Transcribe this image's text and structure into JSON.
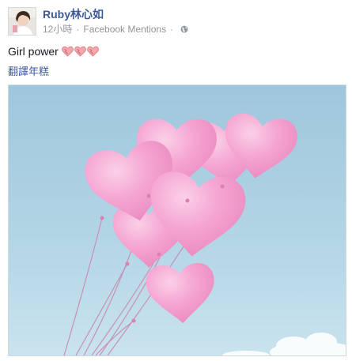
{
  "post": {
    "author_name": "Ruby林心如",
    "timestamp": "12小時",
    "separator": "·",
    "via": "Facebook Mentions",
    "privacy_icon": "globe-icon",
    "message_text": "Girl power",
    "emoji": "heart-emoji",
    "emoji_count": 3,
    "translate_label": "翻譯年糕",
    "photo_subject": "pink-heart-balloons"
  },
  "colors": {
    "link_blue": "#3b5998",
    "meta_gray": "#90949c",
    "text_dark": "#141823",
    "balloon_pink": "#f4a3cf",
    "sky_blue": "#a9cfe3"
  }
}
